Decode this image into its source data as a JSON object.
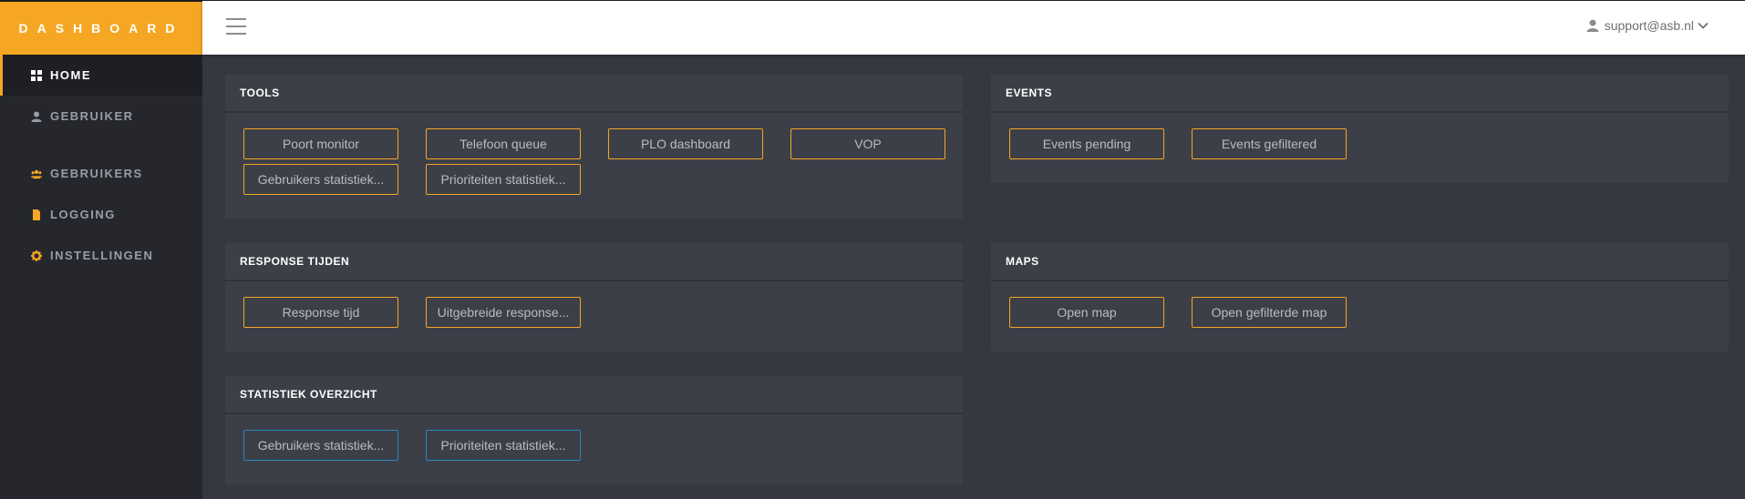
{
  "brand": {
    "title": "DASHBOARD"
  },
  "sidebar": {
    "items": [
      {
        "label": "HOME",
        "icon": "grid-icon"
      },
      {
        "label": "GEBRUIKER",
        "icon": "user-icon"
      },
      {
        "label": "GEBRUIKERS",
        "icon": "users-icon"
      },
      {
        "label": "LOGGING",
        "icon": "file-icon"
      },
      {
        "label": "INSTELLINGEN",
        "icon": "gear-icon"
      }
    ]
  },
  "topbar": {
    "user_email": "support@asb.nl"
  },
  "panels": {
    "tools": {
      "title": "TOOLS",
      "buttons": [
        "Poort monitor",
        "Telefoon queue",
        "PLO dashboard",
        "VOP",
        "Gebruikers statistiek...",
        "Prioriteiten statistiek..."
      ]
    },
    "events": {
      "title": "EVENTS",
      "buttons": [
        "Events pending",
        "Events gefiltered"
      ]
    },
    "response": {
      "title": "RESPONSE TIJDEN",
      "buttons": [
        "Response tijd",
        "Uitgebreide response..."
      ]
    },
    "maps": {
      "title": "MAPS",
      "buttons": [
        "Open map",
        "Open gefilterde map"
      ]
    },
    "stats": {
      "title": "STATISTIEK OVERZICHT",
      "buttons": [
        "Gebruikers statistiek...",
        "Prioriteiten statistiek..."
      ]
    }
  },
  "colors": {
    "accent": "#f5a623",
    "blue": "#2b86c4",
    "sidebar": "#25272d",
    "content": "#353840",
    "panel": "#3c3f47"
  }
}
